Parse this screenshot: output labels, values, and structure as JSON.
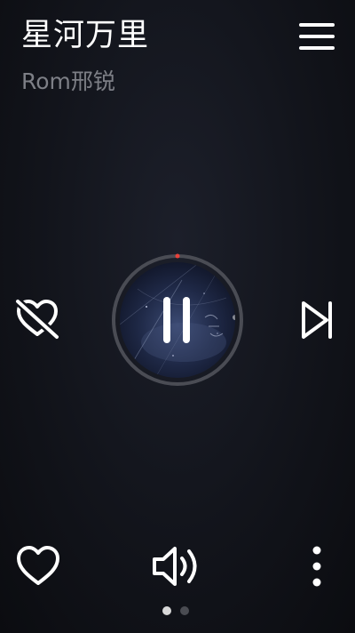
{
  "now_playing": {
    "title": "星河万里",
    "artist": "Rom邢锐"
  },
  "playback": {
    "state": "playing",
    "progress": 0.0
  },
  "controls": {
    "menu_icon": "menu-icon",
    "dislike_icon": "heart-off-icon",
    "pause_icon": "pause-icon",
    "next_icon": "skip-next-icon",
    "like_icon": "heart-icon",
    "volume_icon": "volume-icon",
    "more_icon": "more-vertical-icon"
  },
  "pager": {
    "count": 2,
    "active_index": 0
  },
  "colors": {
    "background": "#12141b",
    "text_primary": "#ffffff",
    "text_secondary": "#7d7f86",
    "progress_accent": "#e8413a",
    "ring_track": "#4a4c54",
    "dot_active": "#d8d8d8",
    "dot_inactive": "#4a4c52"
  }
}
